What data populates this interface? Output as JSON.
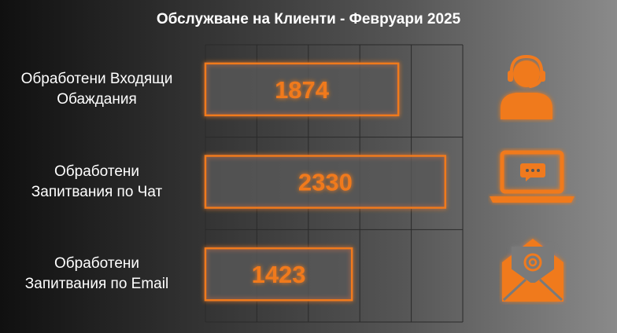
{
  "chart_data": {
    "type": "bar",
    "orientation": "horizontal",
    "title": "Обслужване на Клиенти - Февруари 2025",
    "categories": [
      [
        "Обработени Входящи",
        "Обаждания"
      ],
      [
        "Обработени",
        "Запитвания по Чат"
      ],
      [
        "Обработени",
        "Запитвания по Email"
      ]
    ],
    "values": [
      1874,
      2330,
      1423
    ],
    "xlim": [
      0,
      2500
    ],
    "grid": true,
    "data_labels": true
  },
  "icons": [
    "headset-agent-icon",
    "laptop-chat-icon",
    "email-envelope-icon"
  ],
  "colors": {
    "accent": "#f07a1e",
    "bar_fill": "#5a5a5a",
    "label_text": "#ffffff",
    "grid": "#2a2a2a"
  }
}
